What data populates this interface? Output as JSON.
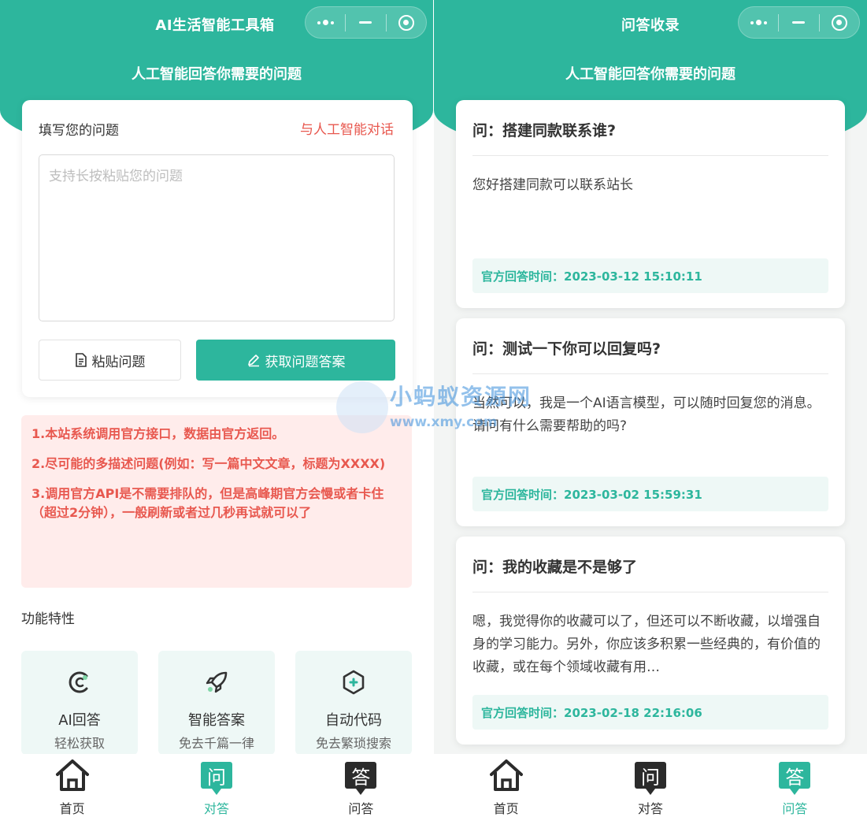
{
  "left": {
    "nav_title": "AI生活智能工具箱",
    "subtitle": "人工智能回答你需要的问题",
    "question_card": {
      "label": "填写您的问题",
      "chat_link": "与人工智能对话",
      "placeholder": "支持长按粘贴您的问题",
      "paste_button": "粘贴问题",
      "answer_button": "获取问题答案"
    },
    "notices": [
      "1.本站系统调用官方接口，数据由官方返回。",
      "2.尽可能的多描述问题(例如：写一篇中文文章，标题为XXXX)",
      "3.调用官方API是不需要排队的，但是高峰期官方会慢或者卡住（超过2分钟），一般刷新或者过几秒再试就可以了"
    ],
    "features_title": "功能特性",
    "features": [
      {
        "name": "AI回答",
        "desc": "轻松获取",
        "icon": "ai-answer-icon"
      },
      {
        "name": "智能答案",
        "desc": "免去千篇一律",
        "icon": "rocket-icon"
      },
      {
        "name": "自动代码",
        "desc": "免去繁琐搜索",
        "icon": "hexagon-plus-icon"
      }
    ],
    "tabs": [
      {
        "label": "首页",
        "icon": "home-icon"
      },
      {
        "label": "对答",
        "icon": "chat-box-icon",
        "glyph": "问",
        "active": true
      },
      {
        "label": "问答",
        "icon": "qa-box-icon",
        "glyph": "答"
      }
    ]
  },
  "right": {
    "nav_title": "问答收录",
    "subtitle": "人工智能回答你需要的问题",
    "answers": [
      {
        "q": "问：搭建同款联系谁?",
        "a": "您好搭建同款可以联系站长",
        "time": "官方回答时间：2023-03-12 15:10:11"
      },
      {
        "q": "问：测试一下你可以回复吗?",
        "a": "当然可以，我是一个AI语言模型，可以随时回复您的消息。请问有什么需要帮助的吗?",
        "time": "官方回答时间：2023-03-02 15:59:31"
      },
      {
        "q": "问：我的收藏是不是够了",
        "a": "嗯，我觉得你的收藏可以了，但还可以不断收藏，以增强自身的学习能力。另外，你应该多积累一些经典的，有价值的收藏，或在每个领域收藏有用…",
        "time": "官方回答时间：2023-02-18 22:16:06"
      }
    ],
    "tabs": [
      {
        "label": "首页",
        "icon": "home-icon"
      },
      {
        "label": "对答",
        "icon": "chat-box-icon",
        "glyph": "问"
      },
      {
        "label": "问答",
        "icon": "qa-box-icon",
        "glyph": "答",
        "active": true
      }
    ]
  },
  "watermark": {
    "title": "小蚂蚁资源网",
    "url": "www.xmy.com"
  },
  "colors": {
    "accent": "#2db69d",
    "warning": "#e8584f",
    "warning_bg": "#ffeceb"
  }
}
